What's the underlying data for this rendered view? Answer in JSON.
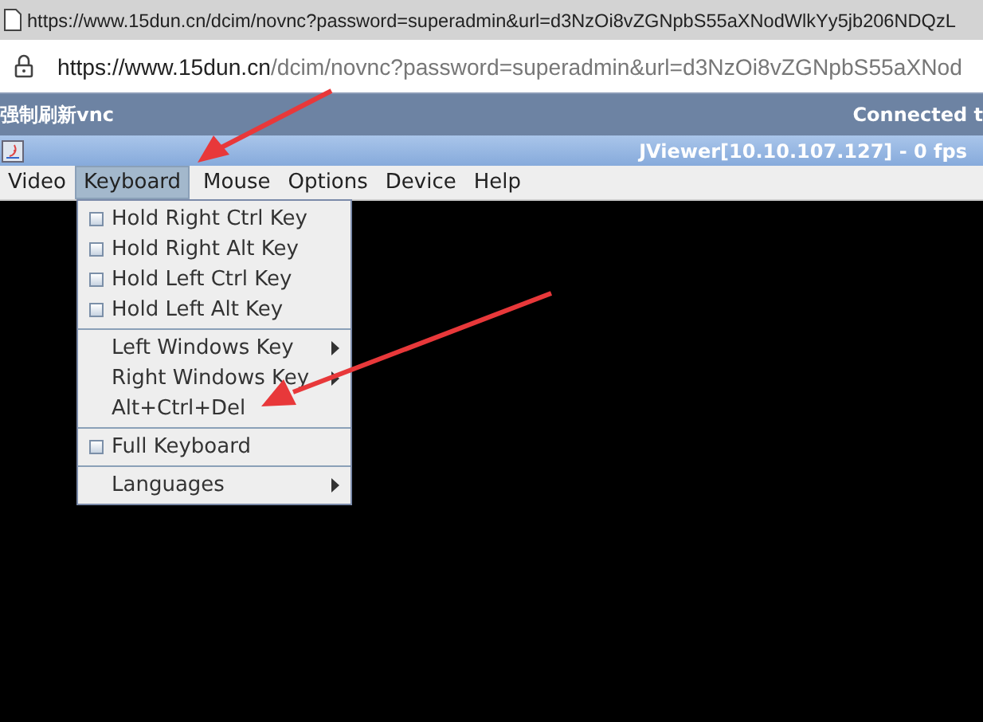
{
  "browser": {
    "tab_url": "https://www.15dun.cn/dcim/novnc?password=superadmin&url=d3NzOi8vZGNpbS55aXNodWlkYy5jb206NDQzL",
    "address_host": "https://www.15dun.cn",
    "address_path": "/dcim/novnc?password=superadmin&url=d3NzOi8vZGNpbS55aXNod"
  },
  "vnc_bar": {
    "title": "强制刷新vnc",
    "status": "Connected t"
  },
  "viewer": {
    "title": "JViewer[10.10.107.127] - 0 fps"
  },
  "menubar": [
    {
      "label": "Video",
      "selected": false
    },
    {
      "label": "Keyboard",
      "selected": true
    },
    {
      "label": "Mouse",
      "selected": false
    },
    {
      "label": "Options",
      "selected": false
    },
    {
      "label": "Device",
      "selected": false
    },
    {
      "label": "Help",
      "selected": false
    }
  ],
  "menu_groups": [
    [
      {
        "kind": "check",
        "label": "Hold Right Ctrl Key",
        "checked": false
      },
      {
        "kind": "check",
        "label": "Hold Right Alt Key",
        "checked": false
      },
      {
        "kind": "check",
        "label": "Hold Left Ctrl Key",
        "checked": false
      },
      {
        "kind": "check",
        "label": "Hold Left Alt Key",
        "checked": false
      }
    ],
    [
      {
        "kind": "submenu",
        "label": "Left Windows Key"
      },
      {
        "kind": "submenu",
        "label": "Right Windows Key"
      },
      {
        "kind": "plain",
        "label": "Alt+Ctrl+Del"
      }
    ],
    [
      {
        "kind": "check",
        "label": "Full Keyboard",
        "checked": false
      }
    ],
    [
      {
        "kind": "submenu",
        "label": "Languages"
      }
    ]
  ]
}
